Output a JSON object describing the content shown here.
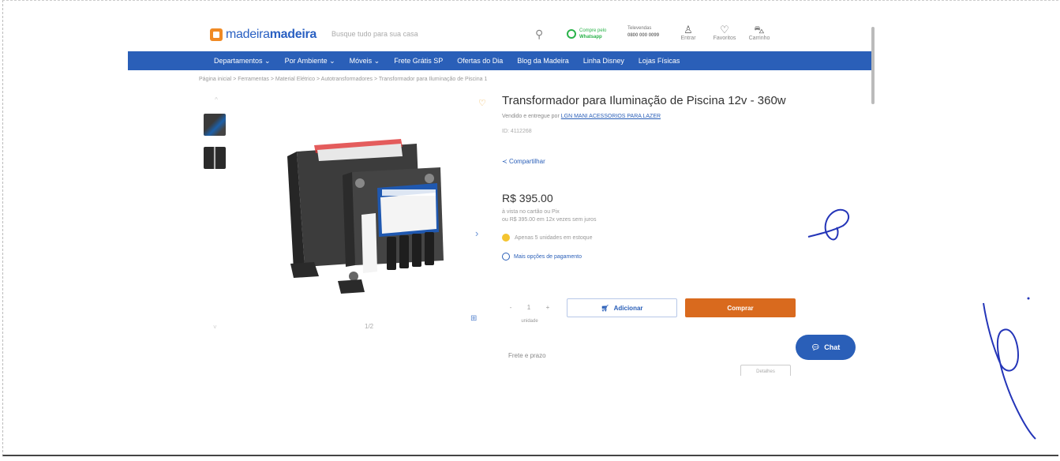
{
  "header": {
    "logo": {
      "text_light": "madeira",
      "text_bold": "madeira"
    },
    "search_placeholder": "Busque tudo para sua casa",
    "whatsapp": {
      "line1": "Compre pelo",
      "line2": "Whatsapp"
    },
    "phone": {
      "label": "Televendas",
      "number": "0800 000 0099"
    },
    "tools": [
      {
        "label": "Entrar",
        "icon": "user-icon"
      },
      {
        "label": "Favoritos",
        "icon": "heart-icon"
      },
      {
        "label": "Carrinho",
        "icon": "cart-icon"
      }
    ]
  },
  "nav": [
    "Departamentos ⌄",
    "Por Ambiente ⌄",
    "Móveis ⌄",
    "Frete Grátis SP",
    "Ofertas do Dia",
    "Blog da Madeira",
    "Linha Disney",
    "Lojas Físicas"
  ],
  "breadcrumb": "Página inicial  >  Ferramentas  >  Material Elétrico  >  Autotransformadores  >  Transformador para Iluminação de Piscina 1",
  "gallery": {
    "counter": "1/2",
    "up": "^",
    "down": "˅"
  },
  "product": {
    "title": "Transformador para Iluminação de Piscina 12v - 360w",
    "seller_prefix": "Vendido e entregue por",
    "seller_name": "LGN MANI ACESSORIOS PARA LAZER",
    "sku": "ID: 4112268",
    "share": "Compartilhar",
    "price": "R$ 395.00",
    "pix": "à vista no cartão ou Pix",
    "installments": "ou R$ 395.00 em 12x vezes sem juros",
    "stock": "Apenas 5 unidades em estoque",
    "payment_options": "Mais opções de pagamento",
    "qty": {
      "minus": "-",
      "value": "1",
      "plus": "+",
      "label": "unidade"
    },
    "add_button": "Adicionar",
    "buy_button": "Comprar",
    "shipping": "Frete e prazo",
    "details_button": "Detalhes"
  },
  "chat": {
    "label": "Chat"
  },
  "colors": {
    "brand_blue": "#2a5fb8",
    "buy_orange": "#d96a1e",
    "whatsapp_green": "#2ab34a"
  }
}
